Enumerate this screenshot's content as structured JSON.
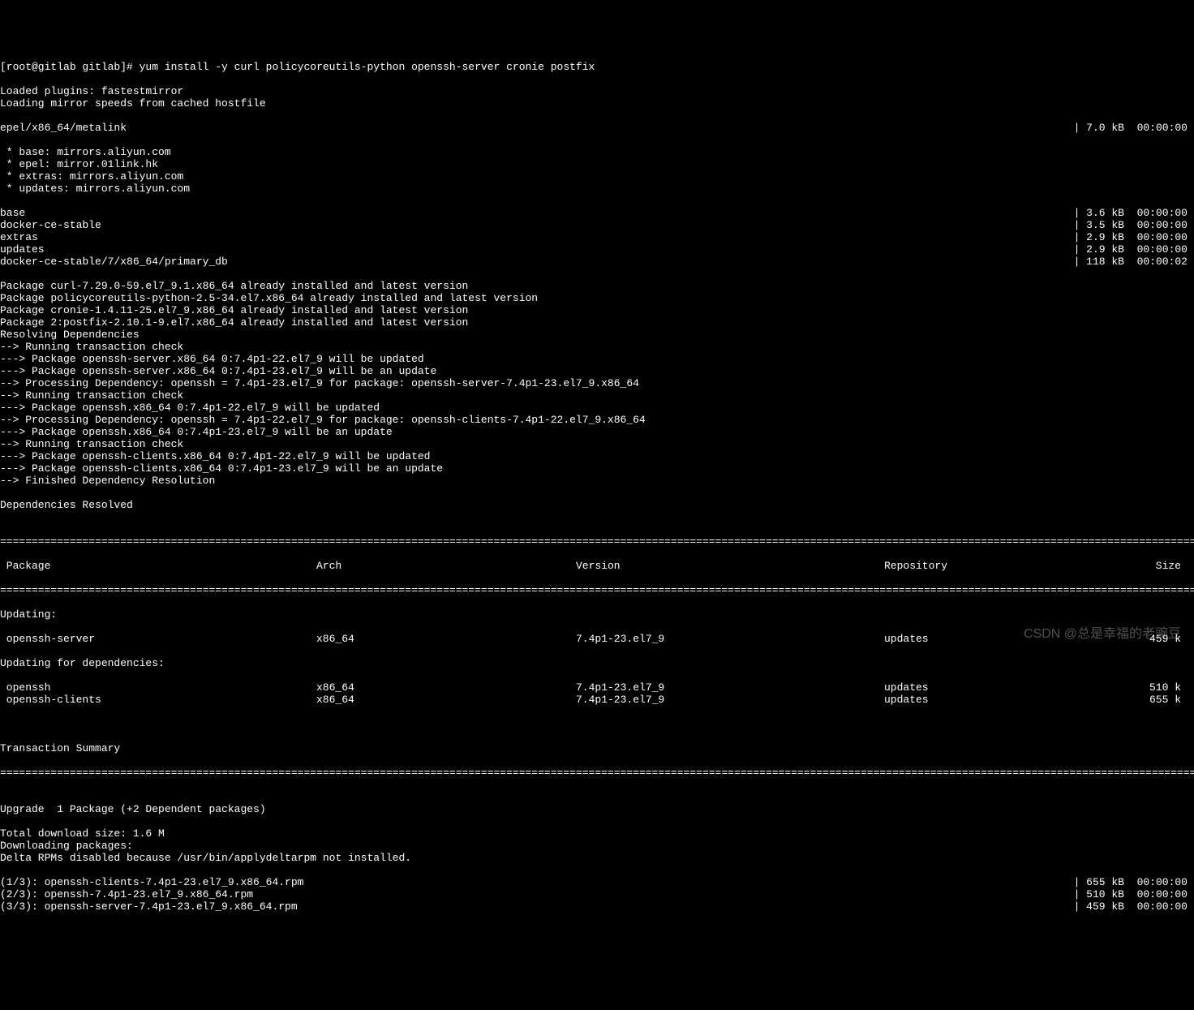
{
  "prompt": "[root@gitlab gitlab]# yum install -y curl policycoreutils-python openssh-server cronie postfix",
  "pre": [
    "Loaded plugins: fastestmirror",
    "Loading mirror speeds from cached hostfile"
  ],
  "repos": [
    {
      "name": "epel/x86_64/metalink",
      "size": "| 7.0 kB  00:00:00"
    }
  ],
  "mirrors": [
    " * base: mirrors.aliyun.com",
    " * epel: mirror.01link.hk",
    " * extras: mirrors.aliyun.com",
    " * updates: mirrors.aliyun.com"
  ],
  "repos2": [
    {
      "name": "base",
      "size": "| 3.6 kB  00:00:00"
    },
    {
      "name": "docker-ce-stable",
      "size": "| 3.5 kB  00:00:00"
    },
    {
      "name": "extras",
      "size": "| 2.9 kB  00:00:00"
    },
    {
      "name": "updates",
      "size": "| 2.9 kB  00:00:00"
    },
    {
      "name": "docker-ce-stable/7/x86_64/primary_db",
      "size": "| 118 kB  00:00:02"
    }
  ],
  "installed": [
    "Package curl-7.29.0-59.el7_9.1.x86_64 already installed and latest version",
    "Package policycoreutils-python-2.5-34.el7.x86_64 already installed and latest version",
    "Package cronie-1.4.11-25.el7_9.x86_64 already installed and latest version",
    "Package 2:postfix-2.10.1-9.el7.x86_64 already installed and latest version",
    "Resolving Dependencies",
    "--> Running transaction check",
    "---> Package openssh-server.x86_64 0:7.4p1-22.el7_9 will be updated",
    "---> Package openssh-server.x86_64 0:7.4p1-23.el7_9 will be an update",
    "--> Processing Dependency: openssh = 7.4p1-23.el7_9 for package: openssh-server-7.4p1-23.el7_9.x86_64",
    "--> Running transaction check",
    "---> Package openssh.x86_64 0:7.4p1-22.el7_9 will be updated",
    "--> Processing Dependency: openssh = 7.4p1-22.el7_9 for package: openssh-clients-7.4p1-22.el7_9.x86_64",
    "---> Package openssh.x86_64 0:7.4p1-23.el7_9 will be an update",
    "--> Running transaction check",
    "---> Package openssh-clients.x86_64 0:7.4p1-22.el7_9 will be updated",
    "---> Package openssh-clients.x86_64 0:7.4p1-23.el7_9 will be an update",
    "--> Finished Dependency Resolution",
    "",
    "Dependencies Resolved",
    ""
  ],
  "headers": {
    "pkg": " Package",
    "arch": "Arch",
    "ver": "Version",
    "repo": "Repository",
    "size": "Size"
  },
  "sections": {
    "updating": "Updating:",
    "updating_deps": "Updating for dependencies:",
    "tx_summary": "Transaction Summary"
  },
  "packages_upd": [
    {
      "pkg": " openssh-server",
      "arch": "x86_64",
      "ver": "7.4p1-23.el7_9",
      "repo": "updates",
      "size": "459 k"
    }
  ],
  "packages_dep": [
    {
      "pkg": " openssh",
      "arch": "x86_64",
      "ver": "7.4p1-23.el7_9",
      "repo": "updates",
      "size": "510 k"
    },
    {
      "pkg": " openssh-clients",
      "arch": "x86_64",
      "ver": "7.4p1-23.el7_9",
      "repo": "updates",
      "size": "655 k"
    }
  ],
  "summary": [
    "",
    "Upgrade  1 Package (+2 Dependent packages)",
    "",
    "Total download size: 1.6 M",
    "Downloading packages:",
    "Delta RPMs disabled because /usr/bin/applydeltarpm not installed."
  ],
  "downloads": [
    {
      "name": "(1/3): openssh-clients-7.4p1-23.el7_9.x86_64.rpm",
      "size": "| 655 kB  00:00:00"
    },
    {
      "name": "(2/3): openssh-7.4p1-23.el7_9.x86_64.rpm",
      "size": "| 510 kB  00:00:00"
    },
    {
      "name": "(3/3): openssh-server-7.4p1-23.el7_9.x86_64.rpm",
      "size": "| 459 kB  00:00:00"
    }
  ],
  "ruler": "==============================================================================================================================================================================================================================",
  "watermark": "CSDN @总是幸福的老豌豆"
}
